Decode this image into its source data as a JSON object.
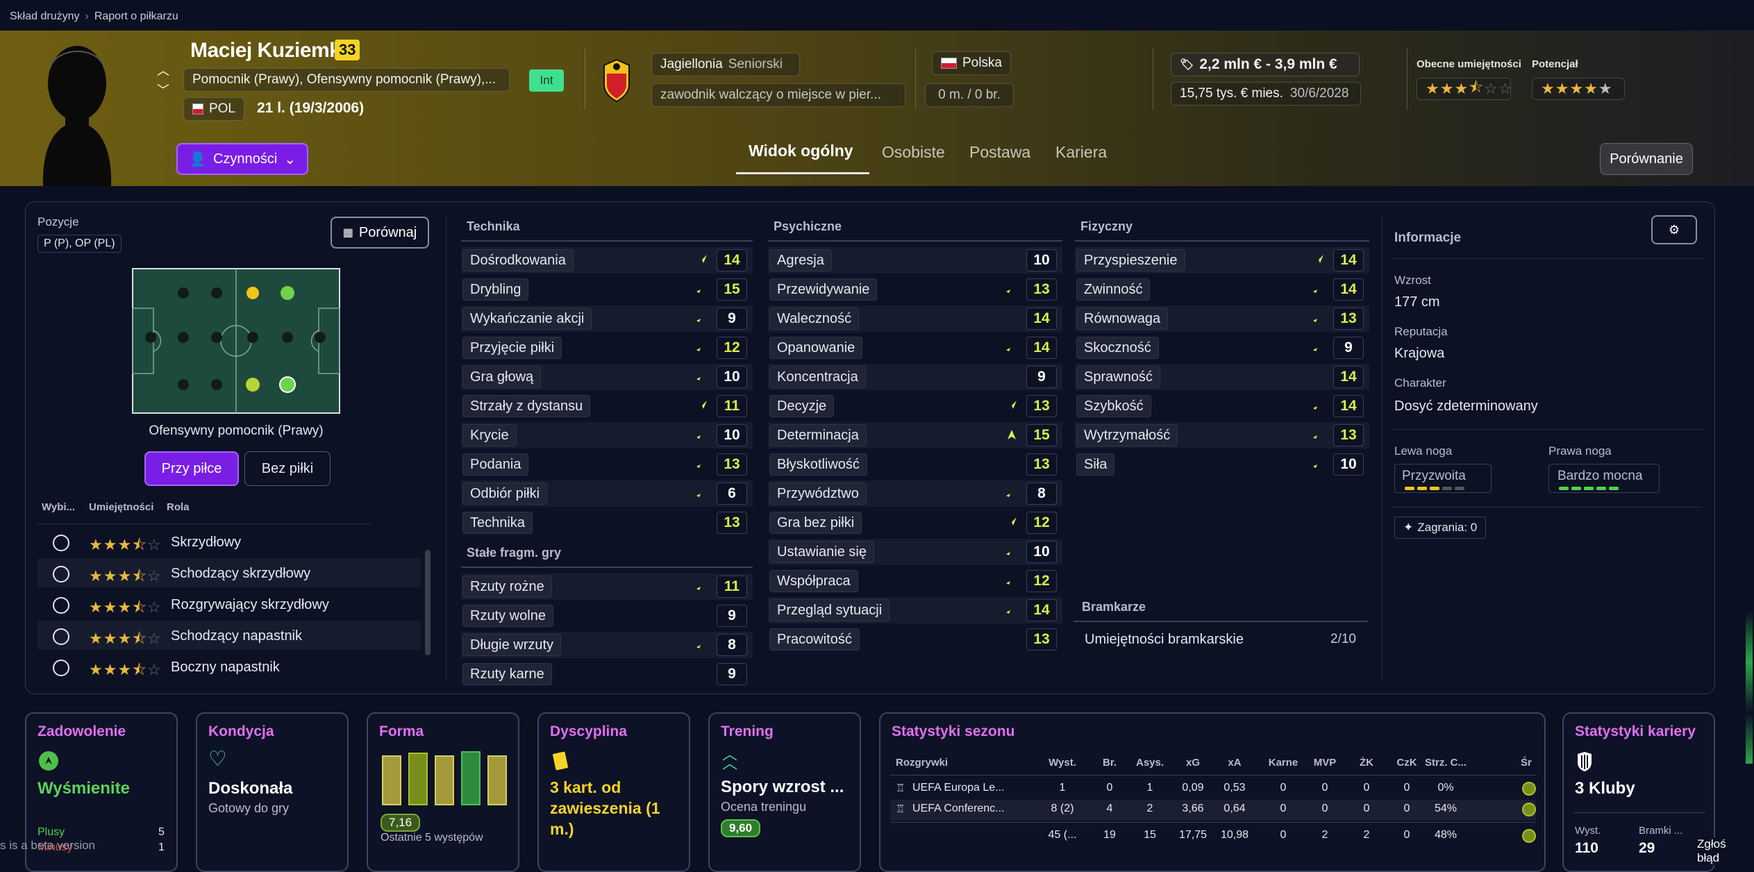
{
  "breadcrumb": {
    "parent": "Skład drużyny",
    "current": "Raport o piłkarzu"
  },
  "player": {
    "name": "Maciej Kuziemka",
    "number": "33",
    "positions": "Pomocnik (Prawy), Ofensywny pomocnik (Prawy),...",
    "nation_code": "POL",
    "age": "21 l. (19/3/2006)",
    "badge": "Int",
    "club": "Jagiellonia",
    "club_team": "Seniorski",
    "squad_status": "zawodnik walczący o miejsce w pier...",
    "nationality": "Polska",
    "caps": "0 m. / 0 br.",
    "value": "2,2 mln € - 3,9 mln €",
    "wage": "15,75 tys. € mies.",
    "contract_end": "30/6/2028",
    "current_ability_label": "Obecne umiejętności",
    "potential_label": "Potencjał"
  },
  "actions": {
    "label": "Czynności",
    "compare": "Porównanie"
  },
  "tabs": [
    "Widok ogólny",
    "Osobiste",
    "Postawa",
    "Kariera"
  ],
  "positions_panel": {
    "title": "Pozycje",
    "codes": "P (P), OP (PL)",
    "compare_btn": "Porównaj",
    "role_caption": "Ofensywny pomocnik (Prawy)",
    "with_ball": "Przy piłce",
    "without_ball": "Bez piłki",
    "col_select": "Wybi...",
    "col_ability": "Umiejętności",
    "col_role": "Rola",
    "roles": [
      {
        "name": "Skrzydłowy",
        "stars": 3.5
      },
      {
        "name": "Schodzący skrzydłowy",
        "stars": 3.5
      },
      {
        "name": "Rozgrywający skrzydłowy",
        "stars": 3.5
      },
      {
        "name": "Schodzący napastnik",
        "stars": 3.5
      },
      {
        "name": "Boczny napastnik",
        "stars": 3.5
      }
    ]
  },
  "technique": {
    "title": "Technika",
    "items": [
      {
        "label": "Dośrodkowania",
        "value": "14"
      },
      {
        "label": "Drybling",
        "value": "15"
      },
      {
        "label": "Wykańczanie akcji",
        "value": "9"
      },
      {
        "label": "Przyjęcie piłki",
        "value": "12"
      },
      {
        "label": "Gra głową",
        "value": "10"
      },
      {
        "label": "Strzały z dystansu",
        "value": "11"
      },
      {
        "label": "Krycie",
        "value": "10"
      },
      {
        "label": "Podania",
        "value": "13"
      },
      {
        "label": "Odbiór piłki",
        "value": "6"
      },
      {
        "label": "Technika",
        "value": "13"
      }
    ]
  },
  "setpieces": {
    "title": "Stałe fragm. gry",
    "items": [
      {
        "label": "Rzuty rożne",
        "value": "11"
      },
      {
        "label": "Rzuty wolne",
        "value": "9"
      },
      {
        "label": "Długie wrzuty",
        "value": "8"
      },
      {
        "label": "Rzuty karne",
        "value": "9"
      }
    ]
  },
  "mental": {
    "title": "Psychiczne",
    "items": [
      {
        "label": "Agresja",
        "value": "10"
      },
      {
        "label": "Przewidywanie",
        "value": "13"
      },
      {
        "label": "Waleczność",
        "value": "14"
      },
      {
        "label": "Opanowanie",
        "value": "14"
      },
      {
        "label": "Koncentracja",
        "value": "9"
      },
      {
        "label": "Decyzje",
        "value": "13"
      },
      {
        "label": "Determinacja",
        "value": "15"
      },
      {
        "label": "Błyskotliwość",
        "value": "13"
      },
      {
        "label": "Przywództwo",
        "value": "8"
      },
      {
        "label": "Gra bez piłki",
        "value": "12"
      },
      {
        "label": "Ustawianie się",
        "value": "10"
      },
      {
        "label": "Współpraca",
        "value": "12"
      },
      {
        "label": "Przegląd sytuacji",
        "value": "14"
      },
      {
        "label": "Pracowitość",
        "value": "13"
      }
    ]
  },
  "physical": {
    "title": "Fizyczny",
    "items": [
      {
        "label": "Przyspieszenie",
        "value": "14"
      },
      {
        "label": "Zwinność",
        "value": "14"
      },
      {
        "label": "Równowaga",
        "value": "13"
      },
      {
        "label": "Skoczność",
        "value": "9"
      },
      {
        "label": "Sprawność",
        "value": "14"
      },
      {
        "label": "Szybkość",
        "value": "14"
      },
      {
        "label": "Wytrzymałość",
        "value": "13"
      },
      {
        "label": "Siła",
        "value": "10"
      }
    ]
  },
  "goalkeeping": {
    "title": "Bramkarze",
    "label": "Umiejętności bramkarskie",
    "value": "2/10"
  },
  "info": {
    "title": "Informacje",
    "height_label": "Wzrost",
    "height": "177 cm",
    "reputation_label": "Reputacja",
    "reputation": "Krajowa",
    "character_label": "Charakter",
    "character": "Dosyć zdeterminowany",
    "left_foot_label": "Lewa noga",
    "left_foot": "Przyzwoita",
    "right_foot_label": "Prawa noga",
    "right_foot": "Bardzo mocna",
    "plays": "Zagrania: 0"
  },
  "cards": {
    "satisfaction": {
      "title": "Zadowolenie",
      "value": "Wyśmienite",
      "plus_label": "Plusy",
      "plus": "5",
      "minus_label": "Minusy",
      "minus": "1"
    },
    "condition": {
      "title": "Kondycja",
      "value": "Doskonała",
      "sub": "Gotowy do gry"
    },
    "form": {
      "title": "Forma",
      "rating": "7,16",
      "sub": "Ostatnie 5 występów"
    },
    "discipline": {
      "title": "Dyscyplina",
      "value": "3 kart. od zawieszenia (1 m.)"
    },
    "training": {
      "title": "Trening",
      "value": "Spory wzrost ...",
      "sub": "Ocena treningu",
      "rating": "9,60"
    },
    "career": {
      "title": "Statystyki kariery",
      "value": "3 Kluby",
      "apps_label": "Wyst.",
      "apps": "110",
      "goals_label": "Bramki ...",
      "goals": "29"
    }
  },
  "season": {
    "title": "Statystyki sezonu",
    "headers": [
      "Rozgrywki",
      "Wyst.",
      "Br.",
      "Asys.",
      "xG",
      "xA",
      "Karne",
      "MVP",
      "ŻK",
      "CzK",
      "Strz. C...",
      "Śr"
    ],
    "rows": [
      [
        "UEFA Europa Le...",
        "1",
        "0",
        "1",
        "0,09",
        "0,53",
        "0",
        "0",
        "0",
        "0",
        "0%"
      ],
      [
        "UEFA Conferenc...",
        "8 (2)",
        "4",
        "2",
        "3,66",
        "0,64",
        "0",
        "0",
        "0",
        "0",
        "54%"
      ],
      [
        "",
        "45 (...",
        "19",
        "15",
        "17,75",
        "10,98",
        "0",
        "2",
        "2",
        "0",
        "48%"
      ]
    ]
  },
  "footer": {
    "beta": "s is a beta version",
    "report": "Zgłoś błąd"
  }
}
